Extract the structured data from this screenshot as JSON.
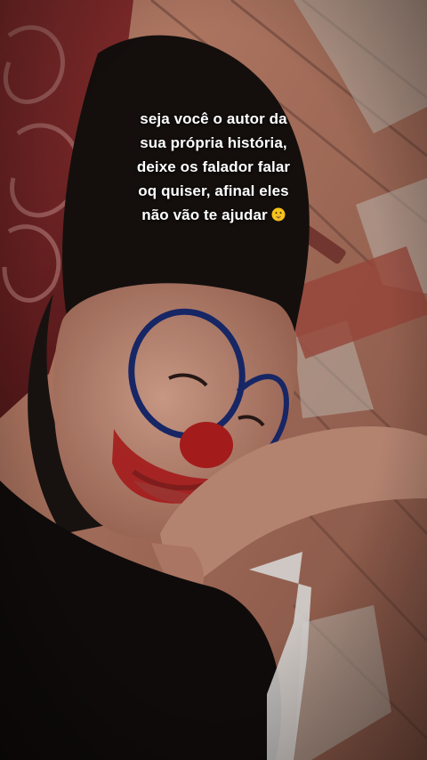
{
  "caption": {
    "lines": [
      "seja você o autor da",
      "sua própria história,",
      "deixe os falador falar",
      "oq quiser, afinal eles",
      "não vão te ajudar"
    ],
    "emoji": "shushing-face-emoji"
  },
  "photo": {
    "subject": "selfie",
    "colors": {
      "brick": "#b8735e",
      "blanket": "#8a2a2a",
      "face_paint_blue": "#1a2a6e",
      "face_paint_red": "#b11e1e",
      "hair": "#15100e"
    }
  }
}
